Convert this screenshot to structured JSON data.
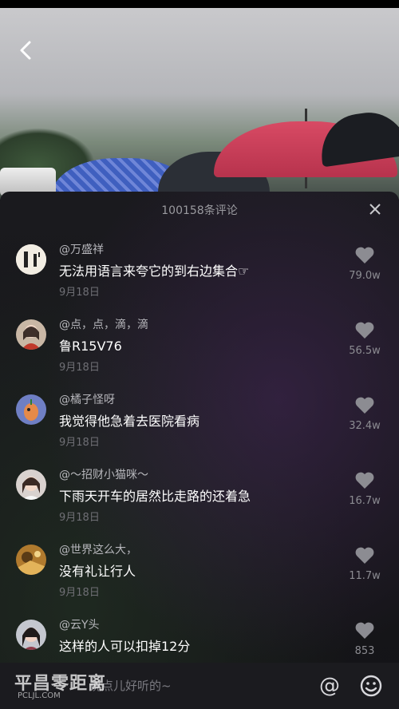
{
  "video": {
    "back_icon": "chevron-left-icon"
  },
  "comments_sheet": {
    "count_label": "100158条评论",
    "close_icon": "close-icon",
    "items": [
      {
        "user": "@万盛祥",
        "text": "无法用语言来夸它的到右边集合☞",
        "date": "9月18日",
        "likes": "79.0w"
      },
      {
        "user": "@点，点，滴，滴",
        "text": "鲁R15V76",
        "date": "9月18日",
        "likes": "56.5w"
      },
      {
        "user": "@橘子怪呀",
        "text": "我觉得他急着去医院看病",
        "date": "9月18日",
        "likes": "32.4w"
      },
      {
        "user": "@～招财小猫咪～",
        "text": "下雨天开车的居然比走路的还着急",
        "date": "9月18日",
        "likes": "16.7w"
      },
      {
        "user": "@世界这么大，",
        "text": "没有礼让行人",
        "date": "9月18日",
        "likes": "11.7w"
      },
      {
        "user": "@云Y头",
        "text": "这样的人可以扣掉12分",
        "date": "",
        "likes": "853"
      }
    ]
  },
  "input_bar": {
    "placeholder": "留下你的精彩评论吧，说点儿好听的~",
    "visible_text": "说点儿好听的~",
    "at_symbol": "@",
    "emoji_icon": "smiley-icon"
  },
  "watermark": {
    "logo": "平昌零距离",
    "url": "PCLJL.COM"
  },
  "colors": {
    "sheet_bg": "#141417",
    "text_primary": "#ffffff",
    "text_secondary": "#b6b6bb",
    "date": "#6f6f75",
    "heart": "#8c8c92"
  }
}
